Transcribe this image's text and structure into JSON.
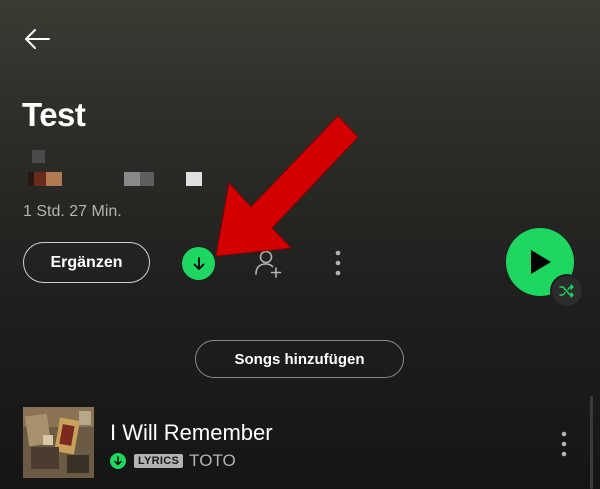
{
  "playlist": {
    "title": "Test",
    "duration": "1 Std. 27 Min."
  },
  "actions": {
    "add_label": "Ergänzen",
    "download_state": "downloaded",
    "add_songs_label": "Songs hinzufügen"
  },
  "tracks": [
    {
      "title": "I Will Remember",
      "badge": "LYRICS",
      "artist": "TOTO",
      "downloaded": true
    }
  ],
  "colors": {
    "accent": "#1ed760",
    "annotation": "#d40000",
    "text_secondary": "#b3b3b3"
  },
  "icons": {
    "back": "arrow-left-icon",
    "download": "arrow-down-icon",
    "add_user": "person-plus-icon",
    "more": "vertical-dots-icon",
    "play": "play-triangle-icon",
    "shuffle": "shuffle-icon"
  }
}
